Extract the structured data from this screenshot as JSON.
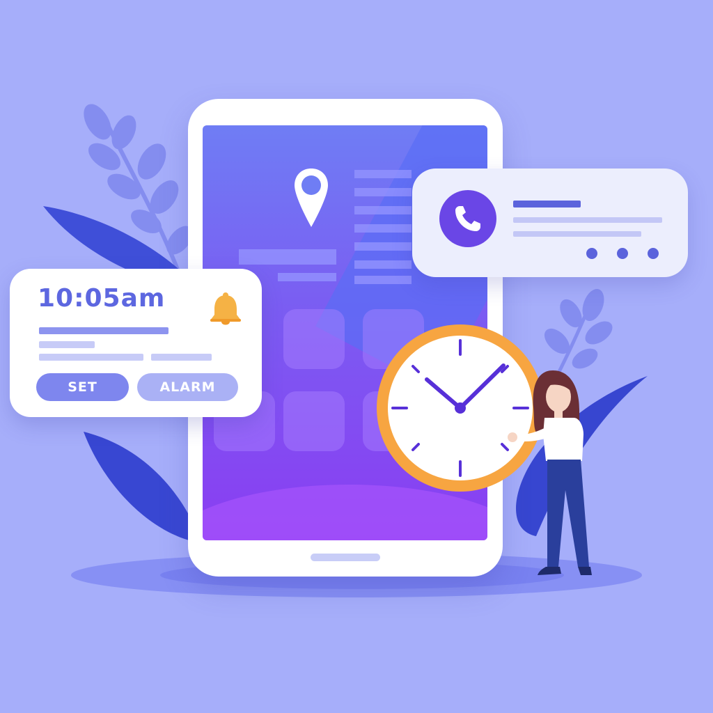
{
  "alarm_card": {
    "time": "10:05am",
    "set_label": "SET",
    "alarm_label": "ALARM",
    "icon": "bell-icon"
  },
  "call_card": {
    "icon": "phone-icon",
    "dots_icon": "more-dots-icon"
  },
  "phone": {
    "screen_icon": "location-pin-icon"
  },
  "clock": {
    "hour": 10,
    "minute": 10
  },
  "colors": {
    "background": "#a6aefa",
    "accent": "#5d67e0",
    "clock_ring": "#f7a541",
    "bell": "#f5b245",
    "call_circle": "#6a46e6"
  }
}
